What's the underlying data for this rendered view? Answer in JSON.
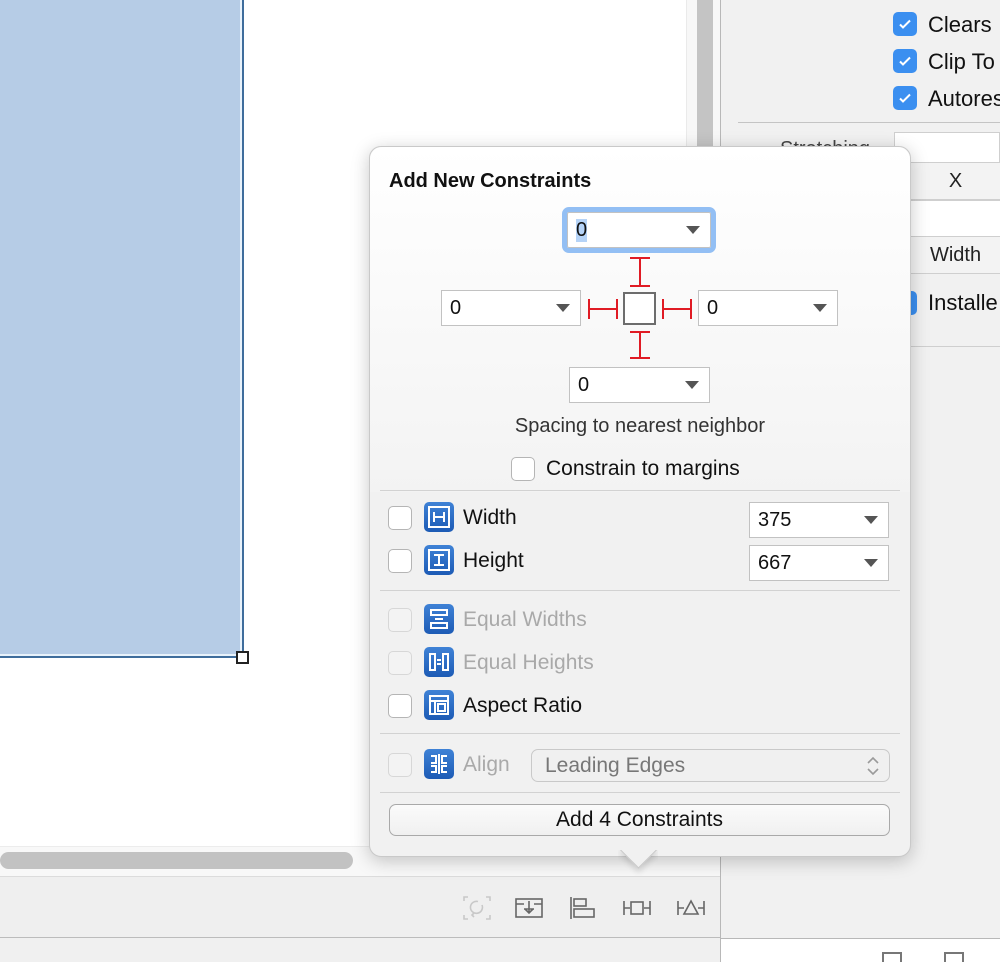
{
  "inspector": {
    "checkboxes": [
      {
        "label": "Clears",
        "checked": true
      },
      {
        "label": "Clip To",
        "checked": true
      },
      {
        "label": "Autores",
        "checked": true
      }
    ],
    "partial_label": "Stretching",
    "columns": {
      "x": "X",
      "width": "Width"
    },
    "installed_label": "Installe"
  },
  "popover": {
    "title": "Add New Constraints",
    "spacing": {
      "top": "0",
      "left": "0",
      "right": "0",
      "bottom": "0"
    },
    "spacing_caption": "Spacing to nearest neighbor",
    "constrain_to_margins": {
      "label": "Constrain to margins",
      "checked": false
    },
    "width": {
      "label": "Width",
      "value": "375",
      "checked": false
    },
    "height": {
      "label": "Height",
      "value": "667",
      "checked": false
    },
    "equal_widths": {
      "label": "Equal Widths",
      "checked": false,
      "enabled": false
    },
    "equal_heights": {
      "label": "Equal Heights",
      "checked": false,
      "enabled": false
    },
    "aspect_ratio": {
      "label": "Aspect Ratio",
      "checked": false
    },
    "align": {
      "label": "Align",
      "selected": "Leading Edges",
      "checked": false,
      "enabled": false
    },
    "add_button": "Add 4 Constraints"
  },
  "colors": {
    "accent_blue": "#3b8ff0",
    "strut_red": "#e01b24",
    "view_fill": "#b6cce6"
  },
  "toolbar": {
    "icons": [
      "update-frames-icon",
      "embed-in-stack-icon",
      "align-icon",
      "pin-icon",
      "resolve-issues-icon"
    ]
  }
}
